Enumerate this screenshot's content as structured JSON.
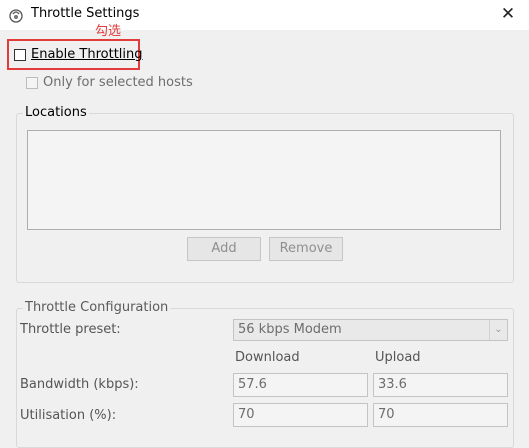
{
  "window": {
    "title": "Throttle Settings",
    "close_symbol": "✕",
    "icon": "fiddler-app-icon"
  },
  "annotation": {
    "note": "勾选",
    "color": "#e23b3b"
  },
  "enable_throttling": {
    "label": "Enable Throttling",
    "checked": false
  },
  "only_selected_hosts": {
    "label": "Only for selected hosts",
    "checked": false,
    "enabled": false
  },
  "locations": {
    "title": "Locations",
    "items": [],
    "add_label": "Add",
    "remove_label": "Remove"
  },
  "throttle_config": {
    "title": "Throttle Configuration",
    "preset_label": "Throttle preset:",
    "preset_value": "56 kbps Modem",
    "download_header": "Download",
    "upload_header": "Upload",
    "bandwidth_label": "Bandwidth (kbps):",
    "bandwidth_download": "57.6",
    "bandwidth_upload": "33.6",
    "utilisation_label": "Utilisation (%):",
    "utilisation_download": "70",
    "utilisation_upload": "70"
  }
}
